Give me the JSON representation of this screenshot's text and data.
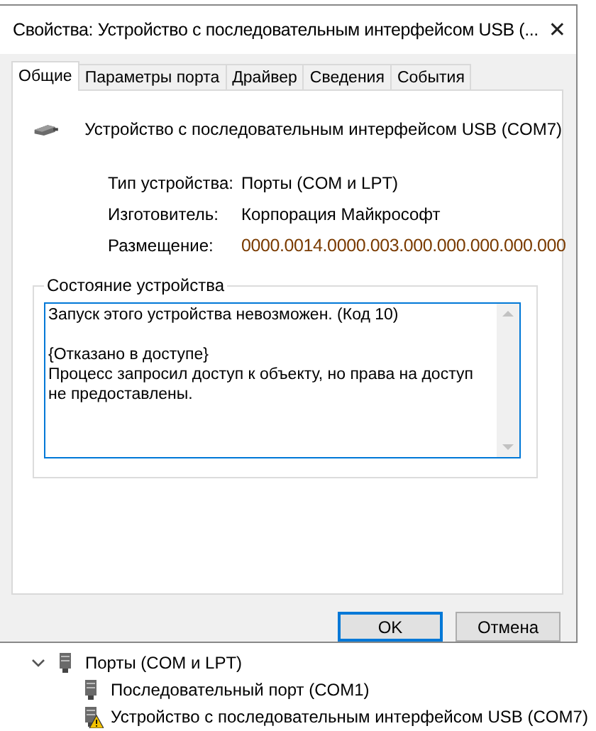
{
  "window": {
    "title": "Свойства: Устройство с последовательным интерфейсом USB (...",
    "close": "✕"
  },
  "tabs": [
    {
      "label": "Общие",
      "selected": true
    },
    {
      "label": "Параметры порта",
      "selected": false
    },
    {
      "label": "Драйвер",
      "selected": false
    },
    {
      "label": "Сведения",
      "selected": false
    },
    {
      "label": "События",
      "selected": false
    }
  ],
  "device": {
    "name": "Устройство с последовательным интерфейсом USB (COM7)"
  },
  "properties": [
    {
      "label": "Тип устройства:",
      "value": "Порты (COM и LPT)",
      "kind": "plain"
    },
    {
      "label": "Изготовитель:",
      "value": "Корпорация Майкрософт",
      "kind": "plain"
    },
    {
      "label": "Размещение:",
      "value": "0000.0014.0000.003.000.000.000.000.000",
      "kind": "location"
    }
  ],
  "status": {
    "title": "Состояние устройства",
    "paragraphs": [
      "Запуск этого устройства невозможен. (Код 10)",
      "{Отказано в доступе}\nПроцесс запросил доступ к объекту, но права на доступ не предоставлены."
    ]
  },
  "buttons": [
    {
      "label": "OK",
      "default": true
    },
    {
      "label": "Отмена",
      "default": false
    }
  ],
  "tree": [
    {
      "label": "Порты (COM и LPT)",
      "expanded": true,
      "children": [
        {
          "label": "Последовательный порт (COM1)",
          "warning": false
        },
        {
          "label": "Устройство с последовательным интерфейсом USB (COM7)",
          "warning": true
        }
      ]
    }
  ]
}
